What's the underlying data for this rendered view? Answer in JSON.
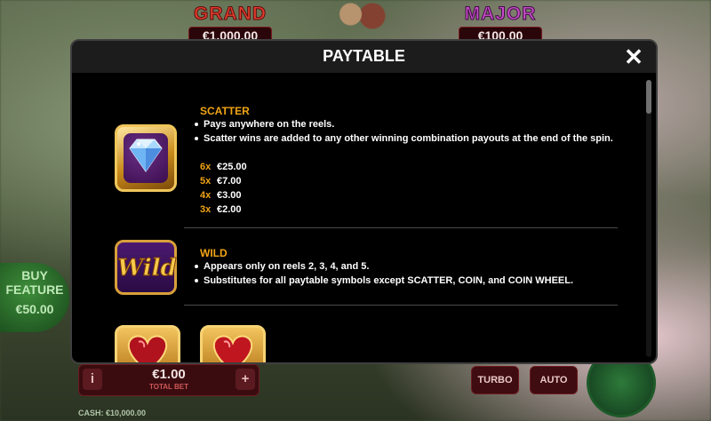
{
  "background": {
    "jackpots": [
      {
        "name": "GRAND",
        "value": "€1,000.00"
      },
      {
        "name": "MAJOR",
        "value": "€100.00"
      }
    ],
    "buy_feature": {
      "line1": "BUY",
      "line2": "FEATURE",
      "price": "€50.00"
    },
    "bet": {
      "info_label": "i",
      "value": "€1.00",
      "label": "TOTAL BET",
      "plus_label": "+"
    },
    "turbo_label": "TURBO",
    "auto_label": "AUTO",
    "cash_text": "CASH: €10,000.00"
  },
  "modal": {
    "title": "PAYTABLE",
    "close_icon": "close-icon",
    "entries": [
      {
        "symbol": "diamond-icon",
        "title": "SCATTER",
        "bullets": [
          "Pays anywhere on the reels.",
          "Scatter wins are added to any other winning combination payouts at the end of the spin."
        ],
        "payouts": [
          {
            "count": "6x",
            "amount": "€25.00"
          },
          {
            "count": "5x",
            "amount": "€7.00"
          },
          {
            "count": "4x",
            "amount": "€3.00"
          },
          {
            "count": "3x",
            "amount": "€2.00"
          }
        ]
      },
      {
        "symbol": "wild-icon",
        "title": "WILD",
        "symbol_text": "Wild",
        "bullets": [
          "Appears only on reels 2, 3, 4, and 5.",
          "Substitutes for all paytable symbols except SCATTER, COIN, and COIN WHEEL."
        ]
      },
      {
        "symbol": "heart-gem-icon"
      }
    ]
  },
  "colors": {
    "accent": "#f1a414",
    "modal_bg": "#000000",
    "header_bg": "#1c1c1c"
  }
}
